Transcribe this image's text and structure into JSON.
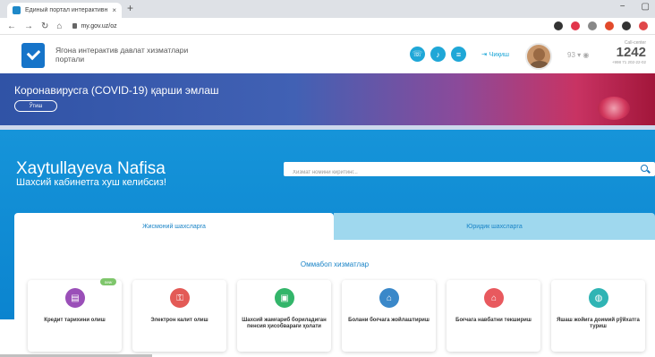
{
  "browser": {
    "tab_title": "Единый портал интерактивн",
    "tab_close": "×",
    "new_tab": "+",
    "url": "my.gov.uz/oz",
    "controls": {
      "minimize": "−",
      "maximize": "▢"
    },
    "nav": {
      "back": "←",
      "forward": "→",
      "reload": "↻",
      "home": "⌂"
    },
    "extension_colors": [
      "#333333",
      "#e2354b",
      "#888888",
      "#e24a2b",
      "#333333",
      "#e0474a"
    ]
  },
  "header": {
    "logo_text": "Ягона интерактив давлат хизматлари портали",
    "login_label": "Чиқиш",
    "temp": "93",
    "call_center": {
      "label": "Call-center",
      "number": "1242",
      "sub": "+998 71 202-22-02"
    },
    "circle_icons": [
      "phone-icon",
      "bell-icon",
      "menu-icon"
    ],
    "accent": "#1fa7d7"
  },
  "covid": {
    "title": "Коронавирусга (COVID-19) қарши эмлаш",
    "button": "Ўтиш"
  },
  "hero": {
    "user_name": "Xaytullayeva Nafisa",
    "welcome": "Шахсий кабинетга хуш келибсиз!",
    "search_placeholder": "Хизмат номини киритинг..."
  },
  "tabs": [
    {
      "label": "Жисмоний шахсларга",
      "active": true
    },
    {
      "label": "Юридик шахсларга",
      "active": false
    }
  ],
  "section_title": "Оммабоп хизматлар",
  "services": [
    {
      "label": "Кредит тарихини олиш",
      "color": "#9a4fb8",
      "icon": "document-icon",
      "badge": "new"
    },
    {
      "label": "Электрон калит олиш",
      "color": "#e35a56",
      "icon": "key-icon"
    },
    {
      "label": "Шахсий жамғариб бориладиган пенсия ҳисобварағи ҳолати",
      "color": "#33b56a",
      "icon": "wallet-icon"
    },
    {
      "label": "Болани боғчага жойлаштириш",
      "color": "#3a88c9",
      "icon": "kindergarten-icon"
    },
    {
      "label": "Боғчага навбатни текшириш",
      "color": "#e8595e",
      "icon": "queue-icon"
    },
    {
      "label": "Яшаш жойига доимий рўйхатга туриш",
      "color": "#2fb4b4",
      "icon": "registration-icon"
    }
  ]
}
